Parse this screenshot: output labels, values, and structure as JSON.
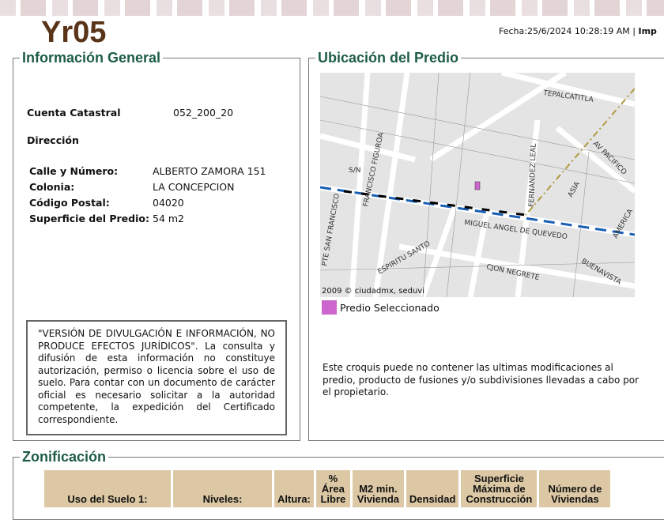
{
  "header": {
    "logo": "Yr05",
    "fecha": "Fecha:25/6/2024 10:28:19 AM | ",
    "imprimir": "Imp"
  },
  "info": {
    "title": "Información General",
    "cuenta_label": "Cuenta Catastral",
    "cuenta": "052_200_20",
    "direccion_label": "Dirección",
    "calle_label": "Calle y Número:",
    "calle": "ALBERTO ZAMORA 151",
    "colonia_label": "Colonia:",
    "colonia": "LA CONCEPCION",
    "cp_label": "Código Postal:",
    "cp": "04020",
    "sup_label": "Superficie del Predio:",
    "sup": "54 m2",
    "disclaimer": "\"VERSIÓN DE DIVULGACIÓN E INFORMACIÓN, NO PRODUCE EFECTOS JURÍDICOS\". La consulta y difusión de esta información no constituye autorización, permiso o licencia sobre el uso de suelo. Para contar con un documento de carácter oficial es necesario solicitar a la autoridad competente, la expedición del Certificado correspondiente."
  },
  "ubicacion": {
    "title": "Ubicación del Predio",
    "copyright": "2009 © ciudadmx, seduvi",
    "legend": "Predio Seleccionado",
    "legend_color": "#cc66cc",
    "streets": [
      "TEPALCATITLA",
      "AV PACIFICO",
      "FRANCISCO FIGUROA",
      "FERNANDEZ LEAL",
      "ASIA",
      "S/N",
      "PTE SAN FRANCISCO",
      "MIGUEL ANGEL DE QUEVEDO",
      "ESPIRITU SANTO",
      "CJON NEGRETE",
      "BUENAVISTA",
      "AMERICA"
    ],
    "note": "Este croquis puede no contener las ultimas modificaciones al predio, producto de fusiones y/o subdivisiones llevadas a cabo por el propietario."
  },
  "zonificacion": {
    "title": "Zonificación",
    "headers": [
      "Uso del Suelo 1:",
      "Niveles:",
      "Altura:",
      "% Área Libre",
      "M2 min. Vivienda",
      "Densidad",
      "Superficie Máxima de Construcción",
      "Número de Viviendas"
    ]
  }
}
